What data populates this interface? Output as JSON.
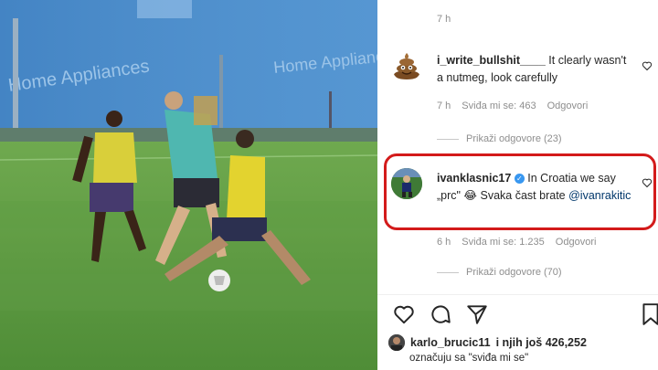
{
  "video": {
    "sponsor_text_1": "Home Appliances",
    "sponsor_text_2": "Home Appliances"
  },
  "top_meta": {
    "time": "7 h"
  },
  "comments": [
    {
      "username": "i_write_bullshit____",
      "text": "It clearly wasn't a nutmeg, look carefully",
      "time": "7 h",
      "likes": "Sviđa mi se: 463",
      "reply": "Odgovori",
      "view_replies": "Prikaži odgovore (23)",
      "avatar_icon": "poop-emoji-icon"
    },
    {
      "username": "ivanklasnic17",
      "verified": true,
      "text": "In Croatia we say „prc\" 😂 Svaka čast brate",
      "mention": "@ivanrakitic",
      "time": "6 h",
      "likes": "Sviđa mi se: 1.235",
      "reply": "Odgovori",
      "view_replies": "Prikaži odgovore (70)",
      "avatar_icon": "football-player-avatar",
      "highlight_color": "#d31b1b"
    }
  ],
  "actions": {
    "like_icon": "heart-icon",
    "comment_icon": "comment-icon",
    "share_icon": "send-icon",
    "save_icon": "bookmark-icon"
  },
  "likes_summary": {
    "user": "karlo_brucic11",
    "rest": "i njih još 426,252",
    "subtext": "označuju sa \"sviđa mi se\""
  },
  "colors": {
    "highlight": "#d31b1b",
    "meta_text": "#8e8e8e",
    "verified": "#3897f0"
  }
}
